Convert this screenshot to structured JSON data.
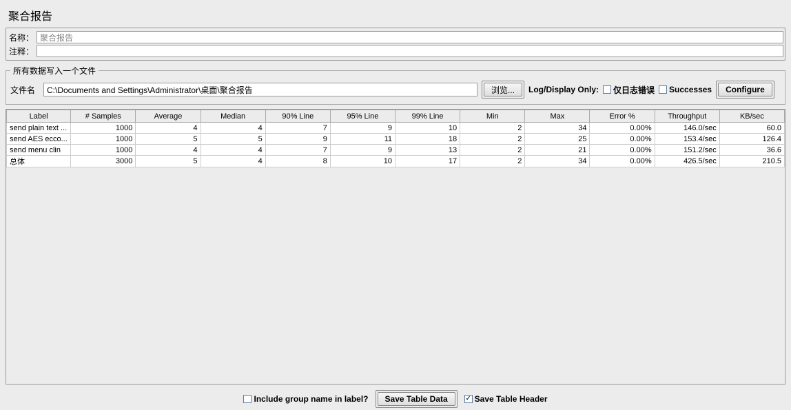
{
  "title": "聚合报告",
  "form": {
    "name_label": "名称：",
    "name_value": "聚合报告",
    "comment_label": "注释：",
    "comment_value": ""
  },
  "file_group": {
    "legend": "所有数据写入一个文件",
    "file_label": "文件名",
    "file_value": "C:\\Documents and Settings\\Administrator\\桌面\\聚合报告",
    "browse": "浏览...",
    "log_display": "Log/Display Only:",
    "only_errors": "仅日志错误",
    "successes": "Successes",
    "configure": "Configure"
  },
  "table": {
    "headers": [
      "Label",
      "# Samples",
      "Average",
      "Median",
      "90% Line",
      "95% Line",
      "99% Line",
      "Min",
      "Max",
      "Error %",
      "Throughput",
      "KB/sec"
    ],
    "rows": [
      {
        "label": "send plain text ...",
        "samples": "1000",
        "avg": "4",
        "median": "4",
        "p90": "7",
        "p95": "9",
        "p99": "10",
        "min": "2",
        "max": "34",
        "err": "0.00%",
        "tp": "146.0/sec",
        "kb": "60.0"
      },
      {
        "label": "send AES ecco...",
        "samples": "1000",
        "avg": "5",
        "median": "5",
        "p90": "9",
        "p95": "11",
        "p99": "18",
        "min": "2",
        "max": "25",
        "err": "0.00%",
        "tp": "153.4/sec",
        "kb": "126.4"
      },
      {
        "label": "send menu clin",
        "samples": "1000",
        "avg": "4",
        "median": "4",
        "p90": "7",
        "p95": "9",
        "p99": "13",
        "min": "2",
        "max": "21",
        "err": "0.00%",
        "tp": "151.2/sec",
        "kb": "36.6"
      },
      {
        "label": "总体",
        "samples": "3000",
        "avg": "5",
        "median": "4",
        "p90": "8",
        "p95": "10",
        "p99": "17",
        "min": "2",
        "max": "34",
        "err": "0.00%",
        "tp": "426.5/sec",
        "kb": "210.5"
      }
    ]
  },
  "bottom": {
    "include_group": "Include group name in label?",
    "save_table_data": "Save Table Data",
    "save_table_header": "Save Table Header"
  },
  "chart_data": {
    "type": "table",
    "title": "聚合报告",
    "columns": [
      "Label",
      "# Samples",
      "Average",
      "Median",
      "90% Line",
      "95% Line",
      "99% Line",
      "Min",
      "Max",
      "Error %",
      "Throughput",
      "KB/sec"
    ],
    "rows": [
      [
        "send plain text ...",
        1000,
        4,
        4,
        7,
        9,
        10,
        2,
        34,
        "0.00%",
        "146.0/sec",
        60.0
      ],
      [
        "send AES ecco...",
        1000,
        5,
        5,
        9,
        11,
        18,
        2,
        25,
        "0.00%",
        "153.4/sec",
        126.4
      ],
      [
        "send menu clin",
        1000,
        4,
        4,
        7,
        9,
        13,
        2,
        21,
        "0.00%",
        "151.2/sec",
        36.6
      ],
      [
        "总体",
        3000,
        5,
        4,
        8,
        10,
        17,
        2,
        34,
        "0.00%",
        "426.5/sec",
        210.5
      ]
    ]
  }
}
